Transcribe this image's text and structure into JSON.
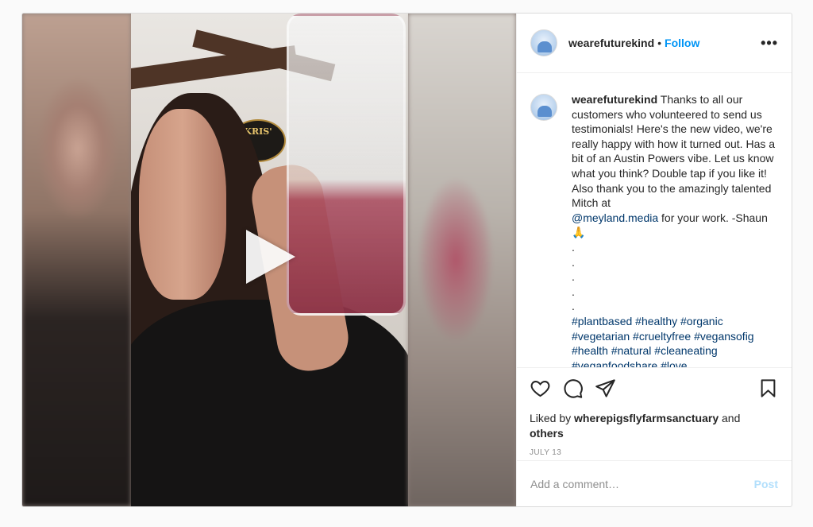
{
  "post": {
    "username": "wearefuturekind",
    "separator": "•",
    "follow_label": "Follow",
    "more_label": "•••",
    "caption": {
      "username": "wearefuturekind",
      "text": "Thanks to all our customers who volunteered to send us testimonials! Here's the new video, we're really happy with how it turned out. Has a bit of an Austin Powers vibe. Let us know what you think? Double tap if you like it! Also thank you to the amazingly talented Mitch at",
      "mention": "@meyland.media",
      "text_after": "for your work. -Shaun",
      "emoji": "🙏",
      "dots": [
        ".",
        ".",
        ".",
        ".",
        "."
      ],
      "hashtags_line1": "#plantbased #healthy #organic",
      "hashtags_line2": "#vegetarian #crueltyfree #vegansofig",
      "hashtags_line3": "#health #natural #cleaneating",
      "hashtags_line4": "#veganfoodshare #love"
    },
    "media": {
      "sign_text": "KRIS'",
      "play_icon": "play-icon"
    },
    "likes": {
      "prefix": "Liked by",
      "user": "wherepigsflyfarmsanctuary",
      "and": "and",
      "others": "others"
    },
    "date": "JULY 13",
    "comment_placeholder": "Add a comment…",
    "post_label": "Post",
    "icons": [
      "heart-icon",
      "comment-icon",
      "share-icon",
      "bookmark-icon"
    ],
    "colors": {
      "accent": "#0095f6",
      "link": "#00376b",
      "post_disabled": "#b2dffc"
    }
  }
}
